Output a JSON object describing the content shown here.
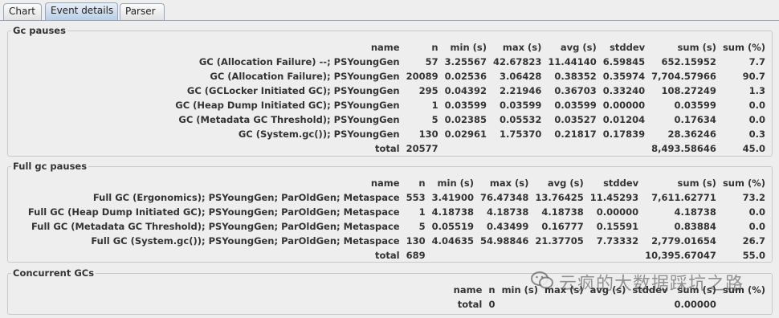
{
  "tabs": [
    "Chart",
    "Event details",
    "Parser"
  ],
  "gc_pauses": {
    "title": "Gc pauses",
    "header": [
      "name",
      "n",
      "min (s)",
      "max (s)",
      "avg (s)",
      "stddev",
      "sum (s)",
      "sum (%)"
    ],
    "rows": [
      [
        "GC (Allocation Failure) --; PSYoungGen",
        "57",
        "3.25567",
        "42.67823",
        "11.44140",
        "6.59845",
        "652.15952",
        "7.7"
      ],
      [
        "GC (Allocation Failure); PSYoungGen",
        "20089",
        "0.02536",
        "3.06428",
        "0.38352",
        "0.35974",
        "7,704.57966",
        "90.7"
      ],
      [
        "GC (GCLocker Initiated GC); PSYoungGen",
        "295",
        "0.04392",
        "2.21946",
        "0.36703",
        "0.33240",
        "108.27249",
        "1.3"
      ],
      [
        "GC (Heap Dump Initiated GC); PSYoungGen",
        "1",
        "0.03599",
        "0.03599",
        "0.03599",
        "0.00000",
        "0.03599",
        "0.0"
      ],
      [
        "GC (Metadata GC Threshold); PSYoungGen",
        "5",
        "0.02385",
        "0.05532",
        "0.03527",
        "0.01204",
        "0.17634",
        "0.0"
      ],
      [
        "GC (System.gc()); PSYoungGen",
        "130",
        "0.02961",
        "1.75370",
        "0.21817",
        "0.17839",
        "28.36246",
        "0.3"
      ]
    ],
    "total": [
      "total",
      "20577",
      "",
      "",
      "",
      "",
      "8,493.58646",
      "45.0"
    ]
  },
  "full_gc_pauses": {
    "title": "Full gc pauses",
    "header": [
      "name",
      "n",
      "min (s)",
      "max (s)",
      "avg (s)",
      "stddev",
      "sum (s)",
      "sum (%)"
    ],
    "rows": [
      [
        "Full GC (Ergonomics); PSYoungGen; ParOldGen; Metaspace",
        "553",
        "3.41900",
        "76.47348",
        "13.76425",
        "11.45293",
        "7,611.62771",
        "73.2"
      ],
      [
        "Full GC (Heap Dump Initiated GC); PSYoungGen; ParOldGen; Metaspace",
        "1",
        "4.18738",
        "4.18738",
        "4.18738",
        "0.00000",
        "4.18738",
        "0.0"
      ],
      [
        "Full GC (Metadata GC Threshold); PSYoungGen; ParOldGen; Metaspace",
        "5",
        "0.05519",
        "0.43499",
        "0.16777",
        "0.15591",
        "0.83884",
        "0.0"
      ],
      [
        "Full GC (System.gc()); PSYoungGen; ParOldGen; Metaspace",
        "130",
        "4.04635",
        "54.98846",
        "21.37705",
        "7.73332",
        "2,779.01654",
        "26.7"
      ]
    ],
    "total": [
      "total",
      "689",
      "",
      "",
      "",
      "",
      "10,395.67047",
      "55.0"
    ]
  },
  "concurrent_gcs": {
    "title": "Concurrent GCs",
    "header": [
      "name",
      "n",
      "min (s)",
      "max (s)",
      "avg (s)",
      "stddev",
      "sum (s)",
      "sum (%)"
    ],
    "rows": [],
    "total": [
      "total",
      "0",
      "",
      "",
      "",
      "",
      "0.00000",
      ""
    ]
  },
  "watermark": {
    "text": "云疯的大数据踩坑之路",
    "icon": "wechat-icon"
  }
}
